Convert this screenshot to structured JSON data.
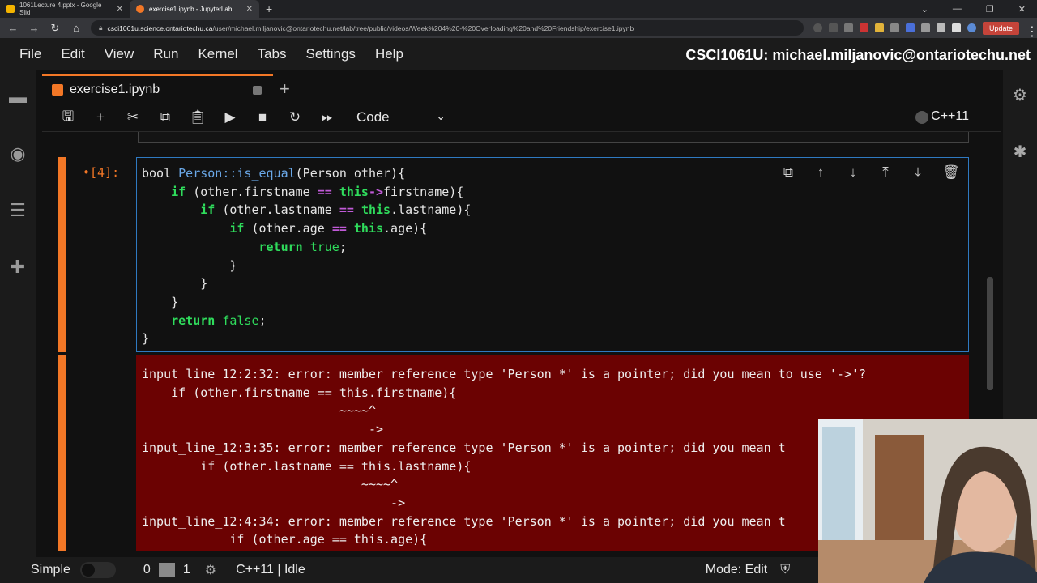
{
  "browser": {
    "tabs": [
      {
        "title": "1061Lecture 4.pptx - Google Slid"
      },
      {
        "title": "exercise1.ipynb - JupyterLab"
      }
    ],
    "url_host": "csci1061u.science.ontariotechu.ca",
    "url_path": "/user/michael.miljanovic@ontariotechu.net/lab/tree/public/videos/Week%204%20-%20Overloading%20and%20Friendship/exercise1.ipynb",
    "update_label": "Update"
  },
  "menu": {
    "items": [
      "File",
      "Edit",
      "View",
      "Run",
      "Kernel",
      "Tabs",
      "Settings",
      "Help"
    ],
    "title_right": "CSCI1061U: michael.miljanovic@ontariotechu.net"
  },
  "notebook": {
    "tab_name": "exercise1.ipynb",
    "cell_type": "Code",
    "kernel": "C++11",
    "prompt": "•[4]:"
  },
  "code_lines": [
    "bool Person::is_equal(Person other){",
    "    if (other.firstname == this->firstname){",
    "        if (other.lastname == this.lastname){",
    "            if (other.age == this.age){",
    "                return true;",
    "            }",
    "        }",
    "    }",
    "    return false;",
    "}"
  ],
  "output_lines": [
    "input_line_12:2:32: error: member reference type 'Person *' is a pointer; did you mean to use '->'?",
    "    if (other.firstname == this.firstname){",
    "                           ~~~~^",
    "                               ->",
    "input_line_12:3:35: error: member reference type 'Person *' is a pointer; did you mean t",
    "        if (other.lastname == this.lastname){",
    "                              ~~~~^",
    "                                  ->",
    "input_line_12:4:34: error: member reference type 'Person *' is a pointer; did you mean t",
    "            if (other.age == this.age){"
  ],
  "status": {
    "mode_label": "Simple",
    "count_left": "0",
    "count_right": "1",
    "kernel_status": "C++11 | Idle",
    "edit_mode": "Mode: Edit"
  },
  "colors": {
    "accent": "#f37726",
    "error_bg": "#6b0202",
    "keyword": "#2fdc5c",
    "selected_border": "#2f7ac2"
  }
}
